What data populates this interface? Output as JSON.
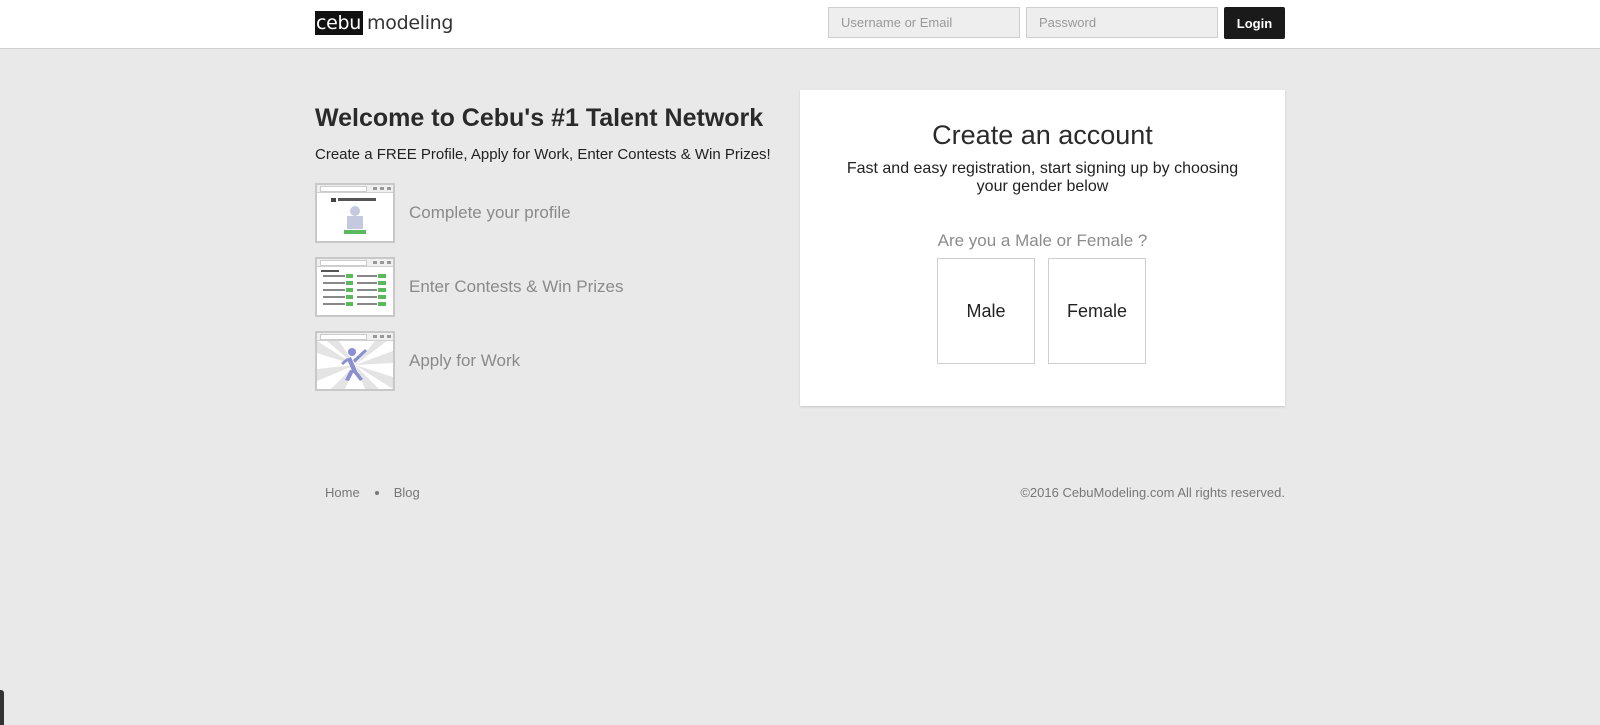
{
  "header": {
    "logo_box_text": "cebu",
    "logo_text": "modeling",
    "username_placeholder": "Username or Email",
    "password_placeholder": "Password",
    "login_label": "Login"
  },
  "welcome": {
    "title": "Welcome to Cebu's #1 Talent Network",
    "subtitle": "Create a FREE Profile, Apply for Work, Enter Contests & Win Prizes!",
    "features": [
      {
        "label": "Complete your profile",
        "icon": "upload-photo-thumbnail-icon"
      },
      {
        "label": "Enter Contests & Win Prizes",
        "icon": "contest-list-thumbnail-icon"
      },
      {
        "label": "Apply for Work",
        "icon": "jumping-person-thumbnail-icon"
      }
    ]
  },
  "register": {
    "title": "Create an account",
    "subtitle": "Fast and easy registration, start signing up by choosing your gender below",
    "question": "Are you a Male or Female ?",
    "male_label": "Male",
    "female_label": "Female"
  },
  "footer": {
    "links": [
      "Home",
      "Blog"
    ],
    "copyright": "©2016 CebuModeling.com All rights reserved."
  },
  "colors": {
    "page_bg": "#e9e9e9",
    "login_button": "#1a1a1a",
    "muted_text": "#8a8a8a"
  }
}
